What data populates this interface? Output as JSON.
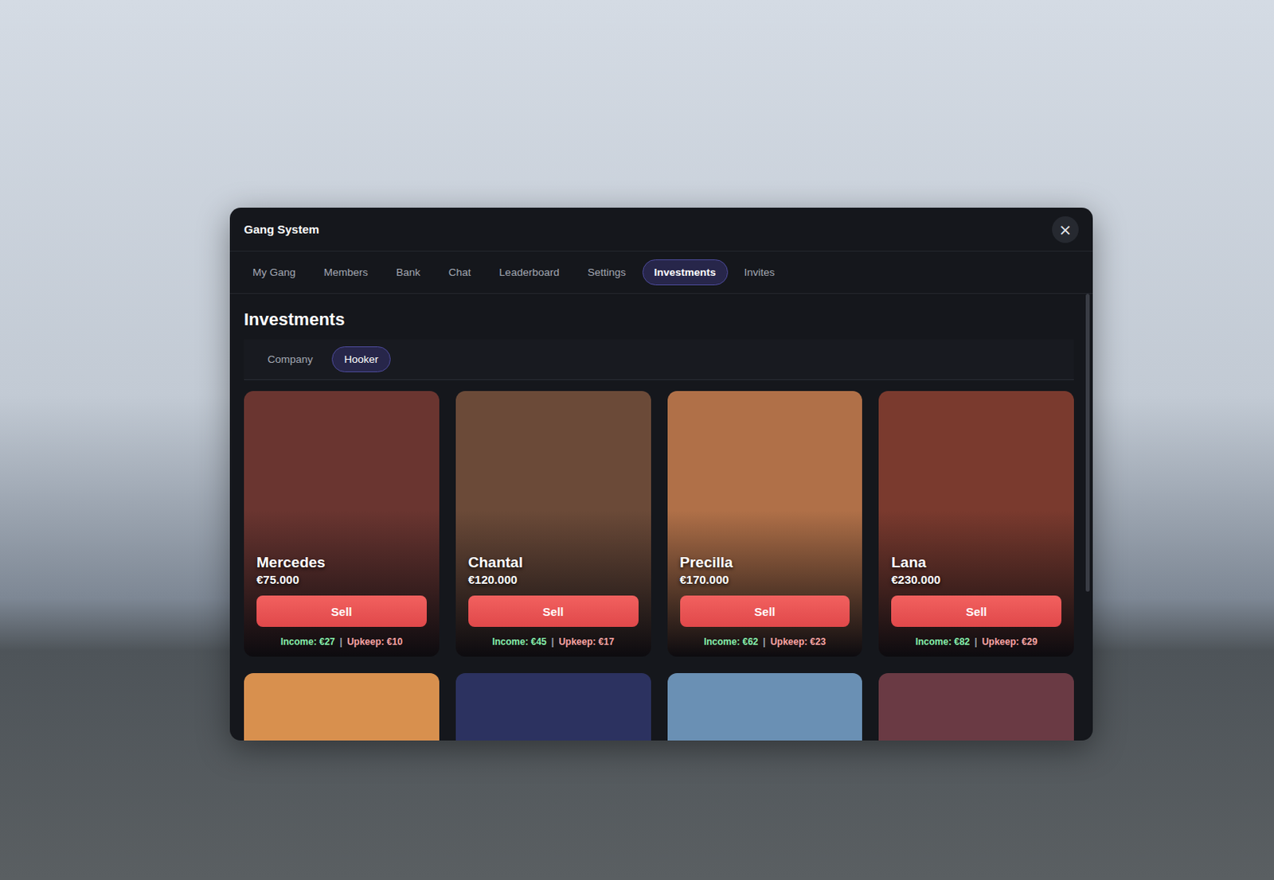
{
  "window": {
    "title": "Gang System",
    "close": "×"
  },
  "tabs": [
    {
      "label": "My Gang",
      "selected": false
    },
    {
      "label": "Members",
      "selected": false
    },
    {
      "label": "Bank",
      "selected": false
    },
    {
      "label": "Chat",
      "selected": false
    },
    {
      "label": "Leaderboard",
      "selected": false
    },
    {
      "label": "Settings",
      "selected": false
    },
    {
      "label": "Investments",
      "selected": true
    },
    {
      "label": "Invites",
      "selected": false
    }
  ],
  "section": {
    "title": "Investments"
  },
  "subtabs": [
    {
      "label": "Company",
      "selected": false
    },
    {
      "label": "Hooker",
      "selected": true
    }
  ],
  "separator": "|",
  "cards": [
    {
      "kind": "full",
      "name": "Mercedes",
      "price": "€75.000",
      "action": "Sell",
      "income": "Income: €27",
      "upkeep": "Upkeep: €10",
      "color": "#6a3530"
    },
    {
      "kind": "full",
      "name": "Chantal",
      "price": "€120.000",
      "action": "Sell",
      "income": "Income: €45",
      "upkeep": "Upkeep: €17",
      "color": "#6b4a38"
    },
    {
      "kind": "full",
      "name": "Precilla",
      "price": "€170.000",
      "action": "Sell",
      "income": "Income: €62",
      "upkeep": "Upkeep: €23",
      "color": "#b07048"
    },
    {
      "kind": "full",
      "name": "Lana",
      "price": "€230.000",
      "action": "Sell",
      "income": "Income: €82",
      "upkeep": "Upkeep: €29",
      "color": "#7a3a2e"
    },
    {
      "kind": "partial",
      "color": "#d8904e"
    },
    {
      "kind": "partial",
      "color": "#2c3260"
    },
    {
      "kind": "partial",
      "color": "#6a90b4"
    },
    {
      "kind": "partial",
      "color": "#6a3a44"
    }
  ]
}
